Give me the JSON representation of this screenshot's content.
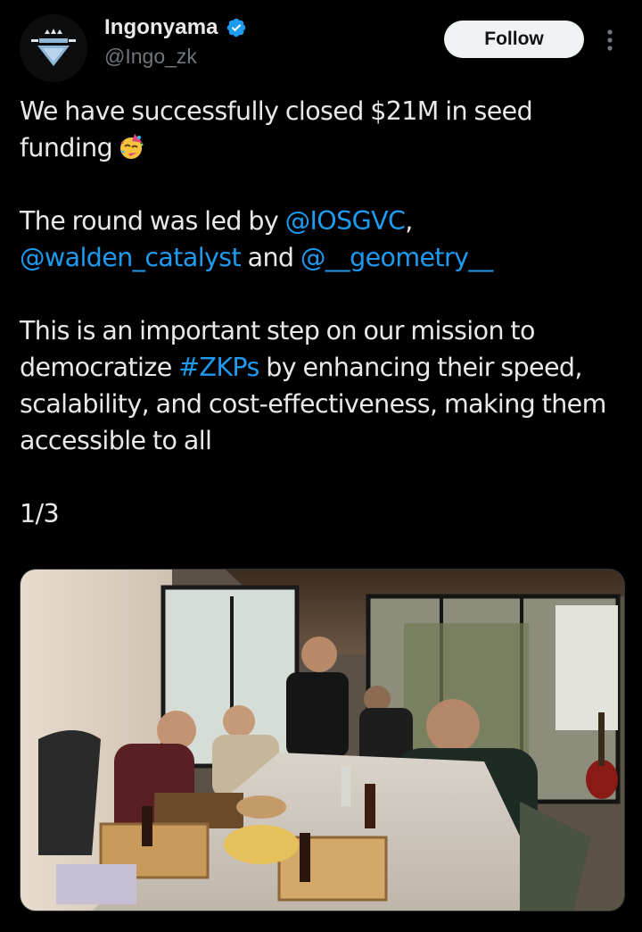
{
  "author": {
    "display_name": "Ingonyama",
    "handle": "@Ingo_zk",
    "verified": true,
    "avatar_icon": "ingonyama-logo-icon"
  },
  "actions": {
    "follow_label": "Follow",
    "more_icon": "more-vertical-icon"
  },
  "tweet": {
    "line1_text": "We have successfully closed $21M in seed funding",
    "emoji": "partying-face-emoji",
    "line2_prefix": "The round was led by ",
    "mention1": "@IOSGVC",
    "line2_comma": ",",
    "mention2": "@walden_catalyst",
    "and_text": " and ",
    "mention3": "@__geometry__",
    "line3_prefix": "This is an important step on our mission to democratize ",
    "hashtag": "#ZKPs",
    "line3_suffix": " by enhancing their speed, scalability, and cost-effectiveness, making them accessible to all",
    "thread_index": "1/3"
  },
  "media": {
    "type": "photo",
    "alt_name": "team-photo-around-table"
  },
  "colors": {
    "background": "#000000",
    "text": "#e7e9ea",
    "secondary": "#71767b",
    "link": "#1d9bf0",
    "follow_bg": "#eff3f4",
    "verified": "#1d9bf0"
  }
}
